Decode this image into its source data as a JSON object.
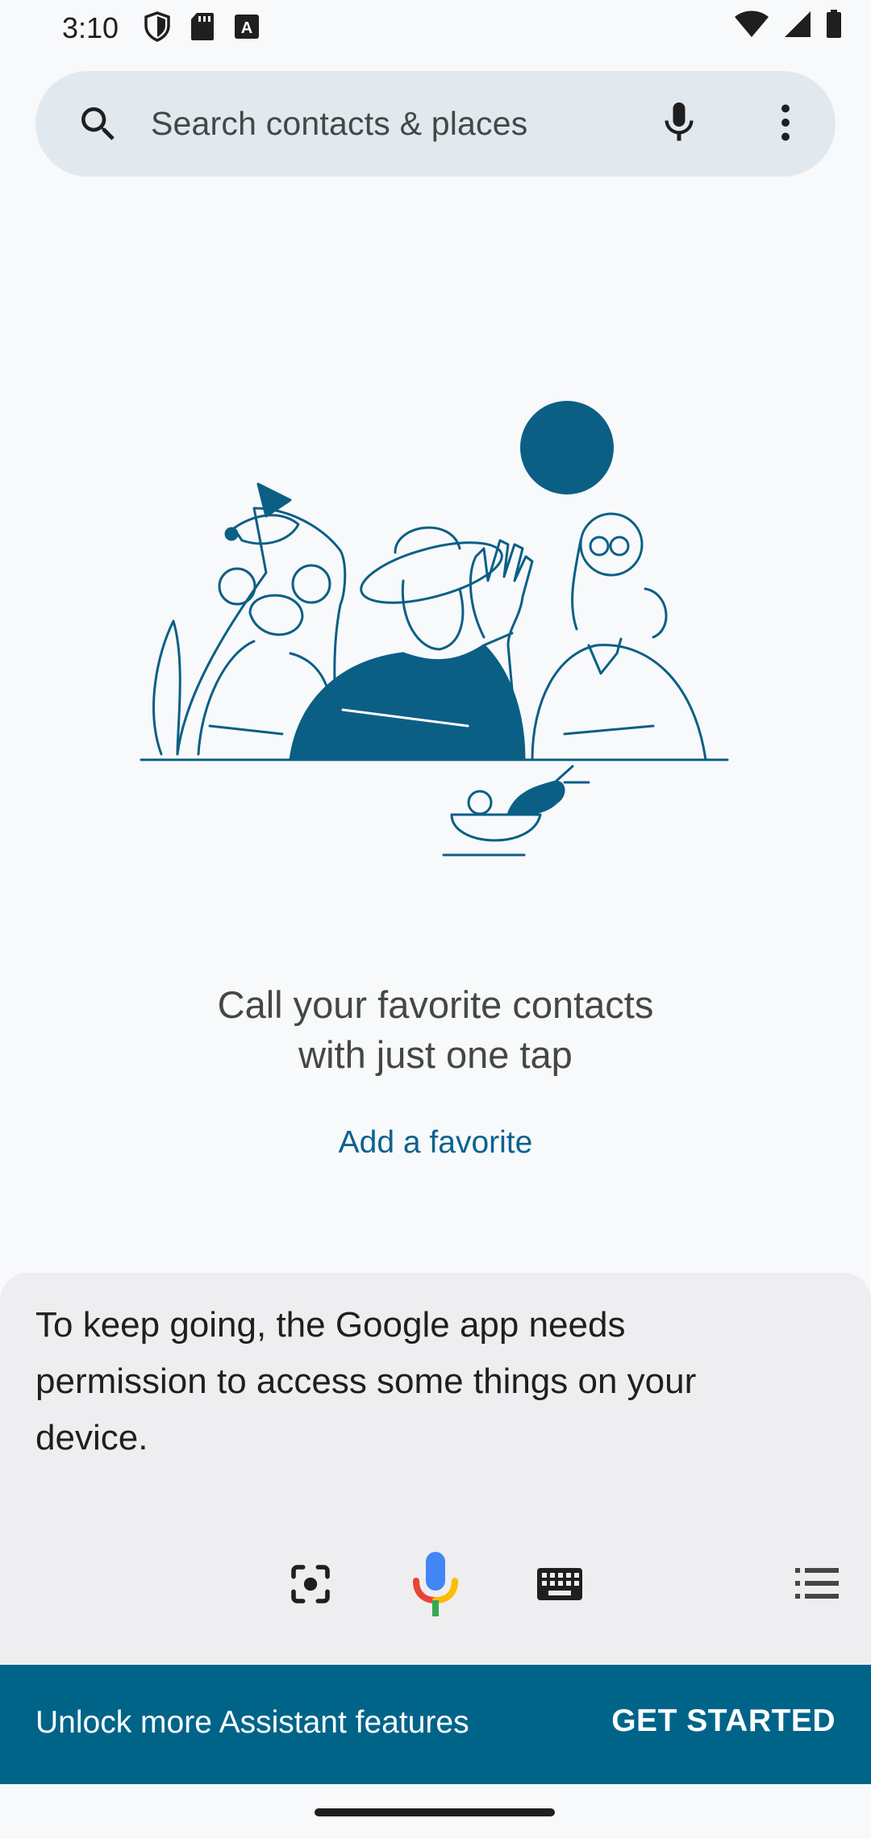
{
  "status_bar": {
    "time": "3:10",
    "left_icons": [
      "shield-icon",
      "sd-card-icon",
      "a-notification-icon"
    ],
    "right_icons": [
      "wifi-icon",
      "signal-icon",
      "battery-icon"
    ]
  },
  "search": {
    "placeholder": "Search contacts & places"
  },
  "favorites_empty": {
    "title_line1": "Call your favorite contacts",
    "title_line2": "with just one tap",
    "add_label": "Add a favorite"
  },
  "assistant": {
    "message": "To keep going, the Google app needs permission to access some things on your device.",
    "icons": [
      "lens-icon",
      "mic-icon",
      "keyboard-icon",
      "list-icon"
    ]
  },
  "banner": {
    "text": "Unlock more Assistant features",
    "action": "GET STARTED"
  },
  "colors": {
    "accent": "#0b628f",
    "banner_bg": "#006489",
    "search_bg": "#e1e9ef",
    "sheet_bg": "#eeeef0"
  }
}
